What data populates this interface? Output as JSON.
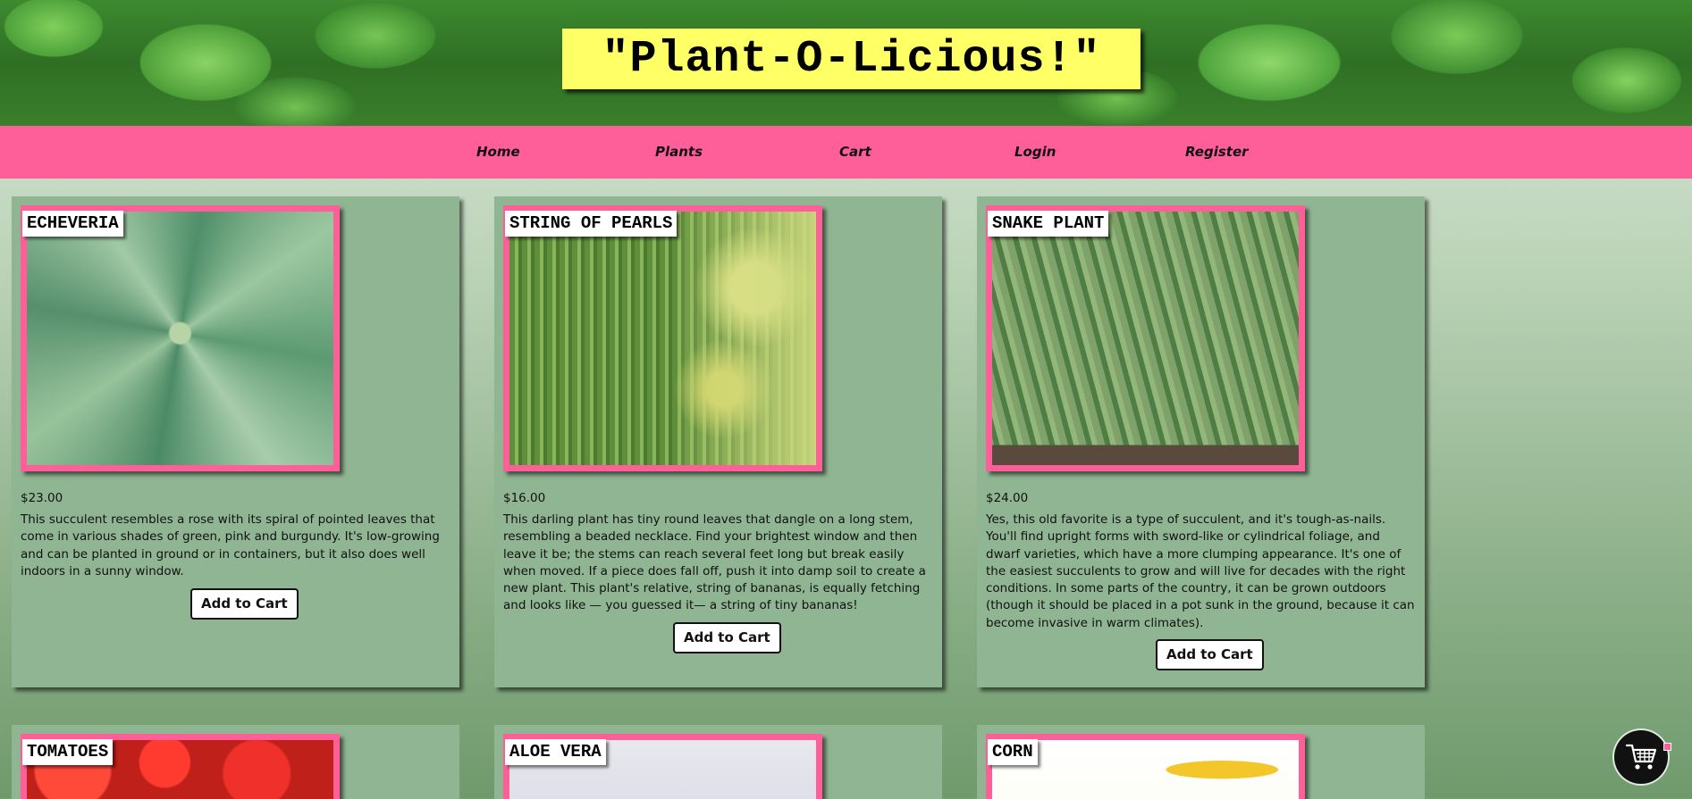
{
  "site": {
    "title": "\"Plant-O-Licious!\""
  },
  "nav": {
    "items": [
      {
        "label": "Home"
      },
      {
        "label": "Plants"
      },
      {
        "label": "Cart"
      },
      {
        "label": "Login"
      },
      {
        "label": "Register"
      }
    ]
  },
  "products": [
    {
      "name": "ECHEVERIA",
      "price": "$23.00",
      "description": "This succulent resembles a rose with its spiral of pointed leaves that come in various shades of green, pink and burgundy. It's low-growing and can be planted in ground or in containers, but it also does well indoors in a sunny window.",
      "button": "Add to Cart"
    },
    {
      "name": "STRING OF PEARLS",
      "price": "$16.00",
      "description": "This darling plant has tiny round leaves that dangle on a long stem, resembling a beaded necklace. Find your brightest window and then leave it be; the stems can reach several feet long but break easily when moved. If a piece does fall off, push it into damp soil to create a new plant. This plant's relative, string of bananas, is equally fetching and looks like — you guessed it— a string of tiny bananas!",
      "button": "Add to Cart"
    },
    {
      "name": "SNAKE PLANT",
      "price": "$24.00",
      "description": "Yes, this old favorite is a type of succulent, and it's tough-as-nails. You'll find upright forms with sword-like or cylindrical foliage, and dwarf varieties, which have a more clumping appearance. It's one of the easiest succulents to grow and will live for decades with the right conditions. In some parts of the country, it can be grown outdoors (though it should be placed in a pot sunk in the ground, because it can become invasive in warm climates).",
      "button": "Add to Cart"
    },
    {
      "name": "TOMATOES"
    },
    {
      "name": "ALOE VERA"
    },
    {
      "name": "CORN"
    }
  ],
  "icons": {
    "floating_cart": "shopping-cart-icon"
  },
  "colors": {
    "nav_bg": "#ff5f98",
    "title_bg": "#ffff66",
    "card_bg": "#8fb592",
    "photo_border": "#ff5f98"
  }
}
